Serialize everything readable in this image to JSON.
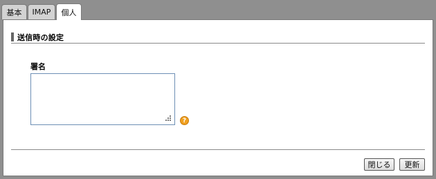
{
  "tabs": [
    {
      "label": "基本",
      "active": false
    },
    {
      "label": "IMAP",
      "active": false
    },
    {
      "label": "個人",
      "active": true
    }
  ],
  "section": {
    "title": "送信時の設定"
  },
  "signature": {
    "label": "署名",
    "value": ""
  },
  "help_icon": {
    "icon": "help-icon",
    "glyph": "?"
  },
  "buttons": {
    "close_label": "閉じる",
    "update_label": "更新"
  },
  "colors": {
    "background": "#8f8f8f",
    "panel": "#ffffff",
    "help": "#f0a020"
  }
}
